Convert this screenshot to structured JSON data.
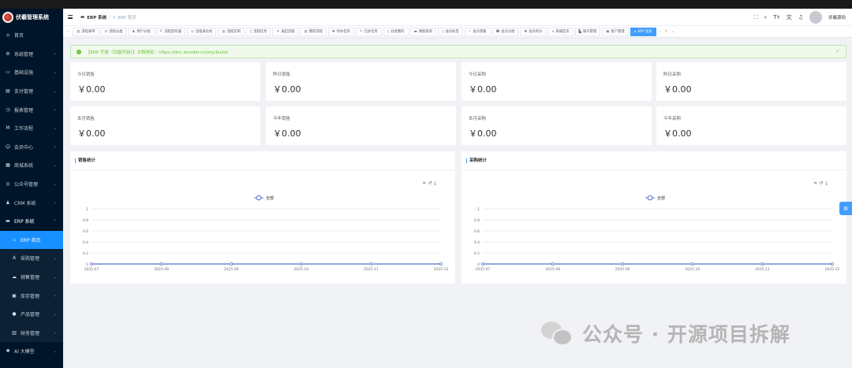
{
  "app": {
    "title": "伏羲管理系统"
  },
  "sidebar": {
    "items": [
      {
        "label": "首页",
        "icon": "home-icon",
        "glyph": "⌂",
        "chevron": false
      },
      {
        "label": "系统管理",
        "icon": "gear-icon",
        "glyph": "⚙",
        "chevron": true
      },
      {
        "label": "基础设施",
        "icon": "monitor-icon",
        "glyph": "▭",
        "chevron": true
      },
      {
        "label": "支付管理",
        "icon": "card-icon",
        "glyph": "▤",
        "chevron": true
      },
      {
        "label": "报表管理",
        "icon": "clock-icon",
        "glyph": "◷",
        "chevron": true
      },
      {
        "label": "工作流程",
        "icon": "flow-icon",
        "glyph": "M",
        "chevron": true
      },
      {
        "label": "会员中心",
        "icon": "members-icon",
        "glyph": "☺",
        "chevron": true
      },
      {
        "label": "商城系统",
        "icon": "shop-icon",
        "glyph": "▦",
        "chevron": true
      },
      {
        "label": "公众号管理",
        "icon": "wechat-icon",
        "glyph": "◎",
        "chevron": true
      },
      {
        "label": "CRM 系统",
        "icon": "user-icon",
        "glyph": "♟",
        "chevron": true
      },
      {
        "label": "ERP 系统",
        "icon": "erp-icon",
        "glyph": "▬",
        "chevron": true,
        "open": true
      }
    ],
    "erp_children": [
      {
        "label": "ERP 首页",
        "icon": "home-icon",
        "glyph": "⌂",
        "chevron": false,
        "active": true
      },
      {
        "label": "采购管理",
        "icon": "purchase-icon",
        "glyph": "A",
        "chevron": true
      },
      {
        "label": "销售管理",
        "icon": "sales-icon",
        "glyph": "☁",
        "chevron": true
      },
      {
        "label": "库存管理",
        "icon": "inventory-icon",
        "glyph": "▣",
        "chevron": true
      },
      {
        "label": "产品管理",
        "icon": "product-icon",
        "glyph": "●",
        "chevron": true
      },
      {
        "label": "财务管理",
        "icon": "finance-icon",
        "glyph": "▥",
        "chevron": true
      }
    ],
    "after_items": [
      {
        "label": "AI 大模型",
        "icon": "ai-icon",
        "glyph": "✺",
        "chevron": true
      }
    ]
  },
  "header": {
    "breadcrumb_root": "ERP 系统",
    "breadcrumb_current": "ERP 首页",
    "username": "伏羲源码"
  },
  "tabs": [
    {
      "label": "流程表单",
      "glyph": "▤"
    },
    {
      "label": "流程分类",
      "glyph": "⇄"
    },
    {
      "label": "用户分组",
      "glyph": "♟"
    },
    {
      "label": "流程监听器",
      "glyph": "⇱"
    },
    {
      "label": "流程表达式",
      "glyph": "◎"
    },
    {
      "label": "流程实例",
      "glyph": "▥"
    },
    {
      "label": "流程任务",
      "glyph": "▯"
    },
    {
      "label": "发起流程",
      "glyph": "✦"
    },
    {
      "label": "我的流程",
      "glyph": "▤"
    },
    {
      "label": "待办任务",
      "glyph": "✽"
    },
    {
      "label": "已办任务",
      "glyph": "✎"
    },
    {
      "label": "抄送我的",
      "glyph": "▯"
    },
    {
      "label": "请假查询",
      "glyph": "▬"
    },
    {
      "label": "会员标签",
      "glyph": "▯"
    },
    {
      "label": "会员等级",
      "glyph": "✓"
    },
    {
      "label": "会员分组",
      "glyph": "☻"
    },
    {
      "label": "会员积分",
      "glyph": "✽"
    },
    {
      "label": "商城首页",
      "glyph": "⌂"
    },
    {
      "label": "账号管理",
      "glyph": "▙"
    },
    {
      "label": "客户管理",
      "glyph": "▣"
    },
    {
      "label": "ERP 首页",
      "glyph": "⌂",
      "active": true
    }
  ],
  "alert": {
    "text": "【ERP 手册（功能开启）】文档地址：https://doc.iocoder.cn/erp/build/"
  },
  "stats": [
    {
      "label": "今日销售",
      "value": "￥0.00"
    },
    {
      "label": "昨日销售",
      "value": "￥0.00"
    },
    {
      "label": "今日采购",
      "value": "￥0.00"
    },
    {
      "label": "昨日采购",
      "value": "￥0.00"
    },
    {
      "label": "本月销售",
      "value": "￥0.00"
    },
    {
      "label": "今年销售",
      "value": "￥0.00"
    },
    {
      "label": "本月采购",
      "value": "￥0.00"
    },
    {
      "label": "今年采购",
      "value": "￥0.00"
    }
  ],
  "chart_data": [
    {
      "type": "line",
      "title": "销售统计",
      "legend": "top-center",
      "series": [
        {
          "name": "全部",
          "values": [
            0,
            0,
            0,
            0,
            0,
            0
          ]
        }
      ],
      "categories": [
        "2025-07",
        "2025-08",
        "2025-09",
        "2025-10",
        "2025-11",
        "2025-12"
      ],
      "yticks": [
        "0",
        "0.2",
        "0.4",
        "0.6",
        "0.8",
        "1"
      ],
      "ylim": [
        0,
        1
      ],
      "grid": true
    },
    {
      "type": "line",
      "title": "采购统计",
      "legend": "top-center",
      "series": [
        {
          "name": "全部",
          "values": [
            0,
            0,
            0,
            0,
            0,
            0
          ]
        }
      ],
      "categories": [
        "2025-07",
        "2025-08",
        "2025-09",
        "2025-10",
        "2025-11",
        "2025-12"
      ],
      "yticks": [
        "0",
        "0.2",
        "0.4",
        "0.6",
        "0.8",
        "1"
      ],
      "ylim": [
        0,
        1
      ],
      "grid": true
    }
  ],
  "colors": {
    "sidebar_bg": "#001529",
    "accent": "#409eff",
    "active_menu": "#1890ff",
    "series_line": "#5470c6"
  },
  "watermark": {
    "text": "公众号 · 开源项目拆解"
  }
}
